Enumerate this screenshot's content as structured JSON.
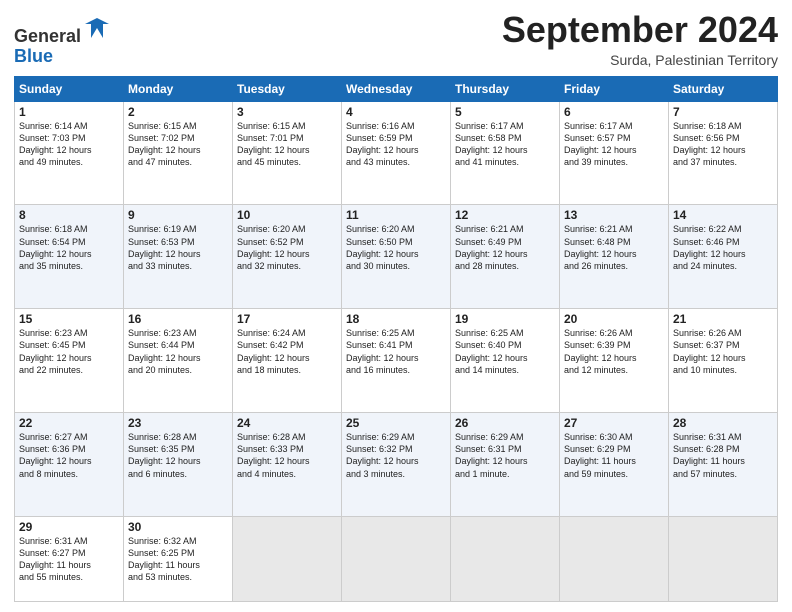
{
  "header": {
    "logo_line1": "General",
    "logo_line2": "Blue",
    "month_title": "September 2024",
    "location": "Surda, Palestinian Territory"
  },
  "weekdays": [
    "Sunday",
    "Monday",
    "Tuesday",
    "Wednesday",
    "Thursday",
    "Friday",
    "Saturday"
  ],
  "weeks": [
    [
      {
        "day": "1",
        "info": "Sunrise: 6:14 AM\nSunset: 7:03 PM\nDaylight: 12 hours\nand 49 minutes."
      },
      {
        "day": "2",
        "info": "Sunrise: 6:15 AM\nSunset: 7:02 PM\nDaylight: 12 hours\nand 47 minutes."
      },
      {
        "day": "3",
        "info": "Sunrise: 6:15 AM\nSunset: 7:01 PM\nDaylight: 12 hours\nand 45 minutes."
      },
      {
        "day": "4",
        "info": "Sunrise: 6:16 AM\nSunset: 6:59 PM\nDaylight: 12 hours\nand 43 minutes."
      },
      {
        "day": "5",
        "info": "Sunrise: 6:17 AM\nSunset: 6:58 PM\nDaylight: 12 hours\nand 41 minutes."
      },
      {
        "day": "6",
        "info": "Sunrise: 6:17 AM\nSunset: 6:57 PM\nDaylight: 12 hours\nand 39 minutes."
      },
      {
        "day": "7",
        "info": "Sunrise: 6:18 AM\nSunset: 6:56 PM\nDaylight: 12 hours\nand 37 minutes."
      }
    ],
    [
      {
        "day": "8",
        "info": "Sunrise: 6:18 AM\nSunset: 6:54 PM\nDaylight: 12 hours\nand 35 minutes."
      },
      {
        "day": "9",
        "info": "Sunrise: 6:19 AM\nSunset: 6:53 PM\nDaylight: 12 hours\nand 33 minutes."
      },
      {
        "day": "10",
        "info": "Sunrise: 6:20 AM\nSunset: 6:52 PM\nDaylight: 12 hours\nand 32 minutes."
      },
      {
        "day": "11",
        "info": "Sunrise: 6:20 AM\nSunset: 6:50 PM\nDaylight: 12 hours\nand 30 minutes."
      },
      {
        "day": "12",
        "info": "Sunrise: 6:21 AM\nSunset: 6:49 PM\nDaylight: 12 hours\nand 28 minutes."
      },
      {
        "day": "13",
        "info": "Sunrise: 6:21 AM\nSunset: 6:48 PM\nDaylight: 12 hours\nand 26 minutes."
      },
      {
        "day": "14",
        "info": "Sunrise: 6:22 AM\nSunset: 6:46 PM\nDaylight: 12 hours\nand 24 minutes."
      }
    ],
    [
      {
        "day": "15",
        "info": "Sunrise: 6:23 AM\nSunset: 6:45 PM\nDaylight: 12 hours\nand 22 minutes."
      },
      {
        "day": "16",
        "info": "Sunrise: 6:23 AM\nSunset: 6:44 PM\nDaylight: 12 hours\nand 20 minutes."
      },
      {
        "day": "17",
        "info": "Sunrise: 6:24 AM\nSunset: 6:42 PM\nDaylight: 12 hours\nand 18 minutes."
      },
      {
        "day": "18",
        "info": "Sunrise: 6:25 AM\nSunset: 6:41 PM\nDaylight: 12 hours\nand 16 minutes."
      },
      {
        "day": "19",
        "info": "Sunrise: 6:25 AM\nSunset: 6:40 PM\nDaylight: 12 hours\nand 14 minutes."
      },
      {
        "day": "20",
        "info": "Sunrise: 6:26 AM\nSunset: 6:39 PM\nDaylight: 12 hours\nand 12 minutes."
      },
      {
        "day": "21",
        "info": "Sunrise: 6:26 AM\nSunset: 6:37 PM\nDaylight: 12 hours\nand 10 minutes."
      }
    ],
    [
      {
        "day": "22",
        "info": "Sunrise: 6:27 AM\nSunset: 6:36 PM\nDaylight: 12 hours\nand 8 minutes."
      },
      {
        "day": "23",
        "info": "Sunrise: 6:28 AM\nSunset: 6:35 PM\nDaylight: 12 hours\nand 6 minutes."
      },
      {
        "day": "24",
        "info": "Sunrise: 6:28 AM\nSunset: 6:33 PM\nDaylight: 12 hours\nand 4 minutes."
      },
      {
        "day": "25",
        "info": "Sunrise: 6:29 AM\nSunset: 6:32 PM\nDaylight: 12 hours\nand 3 minutes."
      },
      {
        "day": "26",
        "info": "Sunrise: 6:29 AM\nSunset: 6:31 PM\nDaylight: 12 hours\nand 1 minute."
      },
      {
        "day": "27",
        "info": "Sunrise: 6:30 AM\nSunset: 6:29 PM\nDaylight: 11 hours\nand 59 minutes."
      },
      {
        "day": "28",
        "info": "Sunrise: 6:31 AM\nSunset: 6:28 PM\nDaylight: 11 hours\nand 57 minutes."
      }
    ],
    [
      {
        "day": "29",
        "info": "Sunrise: 6:31 AM\nSunset: 6:27 PM\nDaylight: 11 hours\nand 55 minutes."
      },
      {
        "day": "30",
        "info": "Sunrise: 6:32 AM\nSunset: 6:25 PM\nDaylight: 11 hours\nand 53 minutes."
      },
      null,
      null,
      null,
      null,
      null
    ]
  ]
}
